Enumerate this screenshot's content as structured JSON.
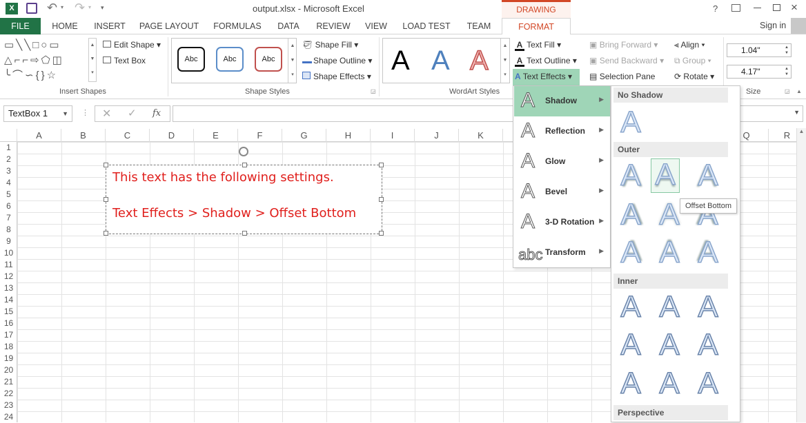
{
  "window": {
    "title": "output.xlsx - Microsoft Excel",
    "context_tab": "DRAWING TOOLS",
    "help": "?"
  },
  "tabs": [
    "FILE",
    "HOME",
    "INSERT",
    "PAGE LAYOUT",
    "FORMULAS",
    "DATA",
    "REVIEW",
    "VIEW",
    "LOAD TEST",
    "TEAM",
    "FORMAT"
  ],
  "user": {
    "signin": "Sign in"
  },
  "ribbon": {
    "insert_shapes": {
      "label": "Insert Shapes",
      "edit_shape": "Edit Shape",
      "text_box": "Text Box"
    },
    "shape_styles": {
      "label": "Shape Styles",
      "samples": [
        "Abc",
        "Abc",
        "Abc"
      ],
      "fill": "Shape Fill",
      "outline": "Shape Outline",
      "effects": "Shape Effects"
    },
    "wordart": {
      "label": "WordArt Styles",
      "letters": [
        "A",
        "A",
        "A"
      ],
      "text_fill": "Text Fill",
      "text_outline": "Text Outline",
      "text_effects": "Text Effects"
    },
    "arrange": {
      "bring_forward": "Bring Forward",
      "send_backward": "Send Backward",
      "selection_pane": "Selection Pane",
      "align": "Align",
      "group": "Group",
      "rotate": "Rotate"
    },
    "size": {
      "label": "Size",
      "height": "1.04\"",
      "width": "4.17\""
    }
  },
  "formula_bar": {
    "name_box": "TextBox 1",
    "fx": "fx",
    "value": ""
  },
  "columns": [
    "A",
    "B",
    "C",
    "D",
    "E",
    "F",
    "G",
    "H",
    "I",
    "J",
    "K",
    "Q",
    "R"
  ],
  "rows": [
    "1",
    "2",
    "3",
    "4",
    "5",
    "6",
    "7",
    "8",
    "9",
    "10",
    "11",
    "12",
    "13",
    "14",
    "15",
    "16",
    "17",
    "18",
    "19",
    "20",
    "21",
    "22",
    "23",
    "24"
  ],
  "textbox": {
    "line1": "This text has the following settings.",
    "line2": "Text Effects > Shadow > Offset Bottom"
  },
  "text_effects_menu": [
    {
      "label": "Shadow",
      "glyph": "A"
    },
    {
      "label": "Reflection",
      "glyph": "A"
    },
    {
      "label": "Glow",
      "glyph": "A"
    },
    {
      "label": "Bevel",
      "glyph": "A"
    },
    {
      "label": "3-D Rotation",
      "glyph": "A"
    },
    {
      "label": "Transform",
      "glyph": "abc"
    }
  ],
  "shadow_submenu": {
    "no_shadow": "No Shadow",
    "outer": "Outer",
    "inner": "Inner",
    "perspective": "Perspective",
    "glyph": "A"
  },
  "tooltip": "Offset Bottom",
  "colors": {
    "file_tab": "#217346",
    "format_tab": "#d24726",
    "selected_item": "#9fd5b7",
    "textbox_text": "#e0201d"
  }
}
